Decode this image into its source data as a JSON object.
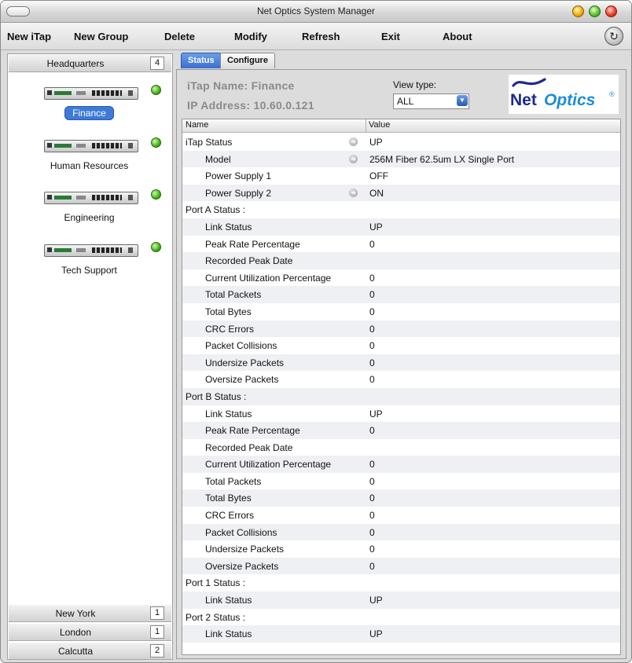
{
  "window": {
    "title": "Net Optics System Manager"
  },
  "menubar": {
    "items": [
      "New iTap",
      "New Group",
      "Delete",
      "Modify",
      "Refresh",
      "Exit",
      "About"
    ],
    "refresh_icon": "↻"
  },
  "sidebar": {
    "top_group": {
      "label": "Headquarters",
      "count": "4"
    },
    "devices": [
      {
        "label": "Finance",
        "status_color": "#44b01c"
      },
      {
        "label": "Human Resources",
        "status_color": "#44b01c"
      },
      {
        "label": "Engineering",
        "status_color": "#44b01c"
      },
      {
        "label": "Tech Support",
        "status_color": "#44b01c"
      }
    ],
    "bottom_groups": [
      {
        "label": "New York",
        "count": "1"
      },
      {
        "label": "London",
        "count": "1"
      },
      {
        "label": "Calcutta",
        "count": "2"
      }
    ]
  },
  "tabs": [
    {
      "label": "Status"
    },
    {
      "label": "Configure"
    }
  ],
  "info": {
    "itap_name": "iTap Name: Finance",
    "ip_address": "IP Address: 10.60.0.121",
    "view_type_label": "View type:",
    "view_type_value": "ALL"
  },
  "logo": {
    "net": "Net",
    "optics": "Optics",
    "reg": "®"
  },
  "table": {
    "headers": {
      "name": "Name",
      "value": "Value"
    },
    "rows": [
      {
        "name": "iTap Status",
        "value": "UP",
        "indent": 0,
        "arrow": true
      },
      {
        "name": "Model",
        "value": "256M Fiber 62.5um LX Single Port",
        "indent": 1,
        "arrow": true
      },
      {
        "name": "Power Supply 1",
        "value": "OFF",
        "indent": 1,
        "arrow": false
      },
      {
        "name": "Power Supply 2",
        "value": "ON",
        "indent": 1,
        "arrow": true
      },
      {
        "name": "Port A Status :",
        "value": "",
        "indent": 0,
        "arrow": false
      },
      {
        "name": "Link Status",
        "value": "UP",
        "indent": 1,
        "arrow": false
      },
      {
        "name": "Peak Rate Percentage",
        "value": "0",
        "indent": 1,
        "arrow": false
      },
      {
        "name": "Recorded Peak Date",
        "value": "",
        "indent": 1,
        "arrow": false
      },
      {
        "name": "Current Utilization Percentage",
        "value": "0",
        "indent": 1,
        "arrow": false
      },
      {
        "name": "Total Packets",
        "value": "0",
        "indent": 1,
        "arrow": false
      },
      {
        "name": "Total Bytes",
        "value": "0",
        "indent": 1,
        "arrow": false
      },
      {
        "name": "CRC Errors",
        "value": "0",
        "indent": 1,
        "arrow": false
      },
      {
        "name": "Packet Collisions",
        "value": "0",
        "indent": 1,
        "arrow": false
      },
      {
        "name": "Undersize Packets",
        "value": "0",
        "indent": 1,
        "arrow": false
      },
      {
        "name": "Oversize Packets",
        "value": "0",
        "indent": 1,
        "arrow": false
      },
      {
        "name": "Port B Status :",
        "value": "",
        "indent": 0,
        "arrow": false
      },
      {
        "name": "Link Status",
        "value": "UP",
        "indent": 1,
        "arrow": false
      },
      {
        "name": "Peak Rate Percentage",
        "value": "0",
        "indent": 1,
        "arrow": false
      },
      {
        "name": "Recorded Peak Date",
        "value": "",
        "indent": 1,
        "arrow": false
      },
      {
        "name": "Current Utilization Percentage",
        "value": "0",
        "indent": 1,
        "arrow": false
      },
      {
        "name": "Total Packets",
        "value": "0",
        "indent": 1,
        "arrow": false
      },
      {
        "name": "Total Bytes",
        "value": "0",
        "indent": 1,
        "arrow": false
      },
      {
        "name": "CRC Errors",
        "value": "0",
        "indent": 1,
        "arrow": false
      },
      {
        "name": "Packet Collisions",
        "value": "0",
        "indent": 1,
        "arrow": false
      },
      {
        "name": "Undersize Packets",
        "value": "0",
        "indent": 1,
        "arrow": false
      },
      {
        "name": "Oversize Packets",
        "value": "0",
        "indent": 1,
        "arrow": false
      },
      {
        "name": "Port 1 Status :",
        "value": "",
        "indent": 0,
        "arrow": false
      },
      {
        "name": "Link Status",
        "value": "UP",
        "indent": 1,
        "arrow": false
      },
      {
        "name": "Port 2 Status :",
        "value": "",
        "indent": 0,
        "arrow": false
      },
      {
        "name": "Link Status",
        "value": "UP",
        "indent": 1,
        "arrow": false
      }
    ]
  },
  "colors": {
    "selected_label_bg": "#3e7ad8",
    "active_tab_bg": "#3a6ed0",
    "status_led": "#44b01c",
    "logo_net": "#1d2a8c",
    "logo_optics": "#1a8ed8"
  }
}
